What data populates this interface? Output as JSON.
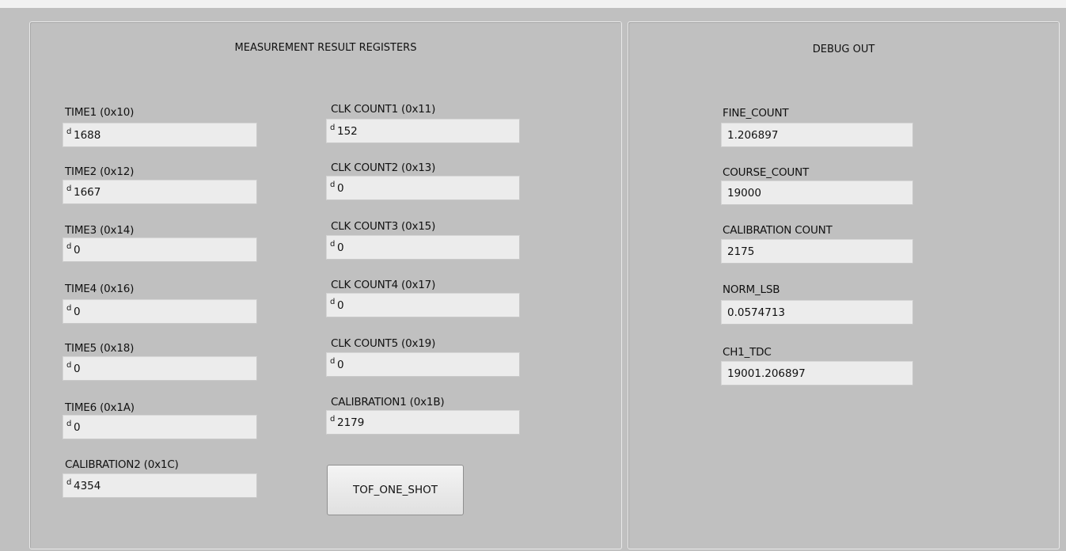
{
  "measurement_panel": {
    "title": "MEASUREMENT RESULT REGISTERS",
    "radix_label": "d",
    "left_registers": [
      {
        "label": "TIME1 (0x10)",
        "value": "1688"
      },
      {
        "label": "TIME2 (0x12)",
        "value": "1667"
      },
      {
        "label": "TIME3 (0x14)",
        "value": "0"
      },
      {
        "label": "TIME4 (0x16)",
        "value": "0"
      },
      {
        "label": "TIME5 (0x18)",
        "value": "0"
      },
      {
        "label": "TIME6 (0x1A)",
        "value": "0"
      },
      {
        "label": "CALIBRATION2 (0x1C)",
        "value": "4354"
      }
    ],
    "right_registers": [
      {
        "label": "CLK COUNT1 (0x11)",
        "value": "152"
      },
      {
        "label": "CLK COUNT2 (0x13)",
        "value": "0"
      },
      {
        "label": "CLK COUNT3 (0x15)",
        "value": "0"
      },
      {
        "label": "CLK COUNT4 (0x17)",
        "value": "0"
      },
      {
        "label": "CLK COUNT5 (0x19)",
        "value": "0"
      },
      {
        "label": "CALIBRATION1 (0x1B)",
        "value": "2179"
      }
    ],
    "button_label": "TOF_ONE_SHOT"
  },
  "debug_panel": {
    "title": "DEBUG OUT",
    "fields": [
      {
        "label": "FINE_COUNT",
        "value": "1.206897"
      },
      {
        "label": "COURSE_COUNT",
        "value": "19000"
      },
      {
        "label": "CALIBRATION COUNT",
        "value": "2175"
      },
      {
        "label": "NORM_LSB",
        "value": "0.0574713"
      },
      {
        "label": "CH1_TDC",
        "value": "19001.206897"
      }
    ]
  }
}
